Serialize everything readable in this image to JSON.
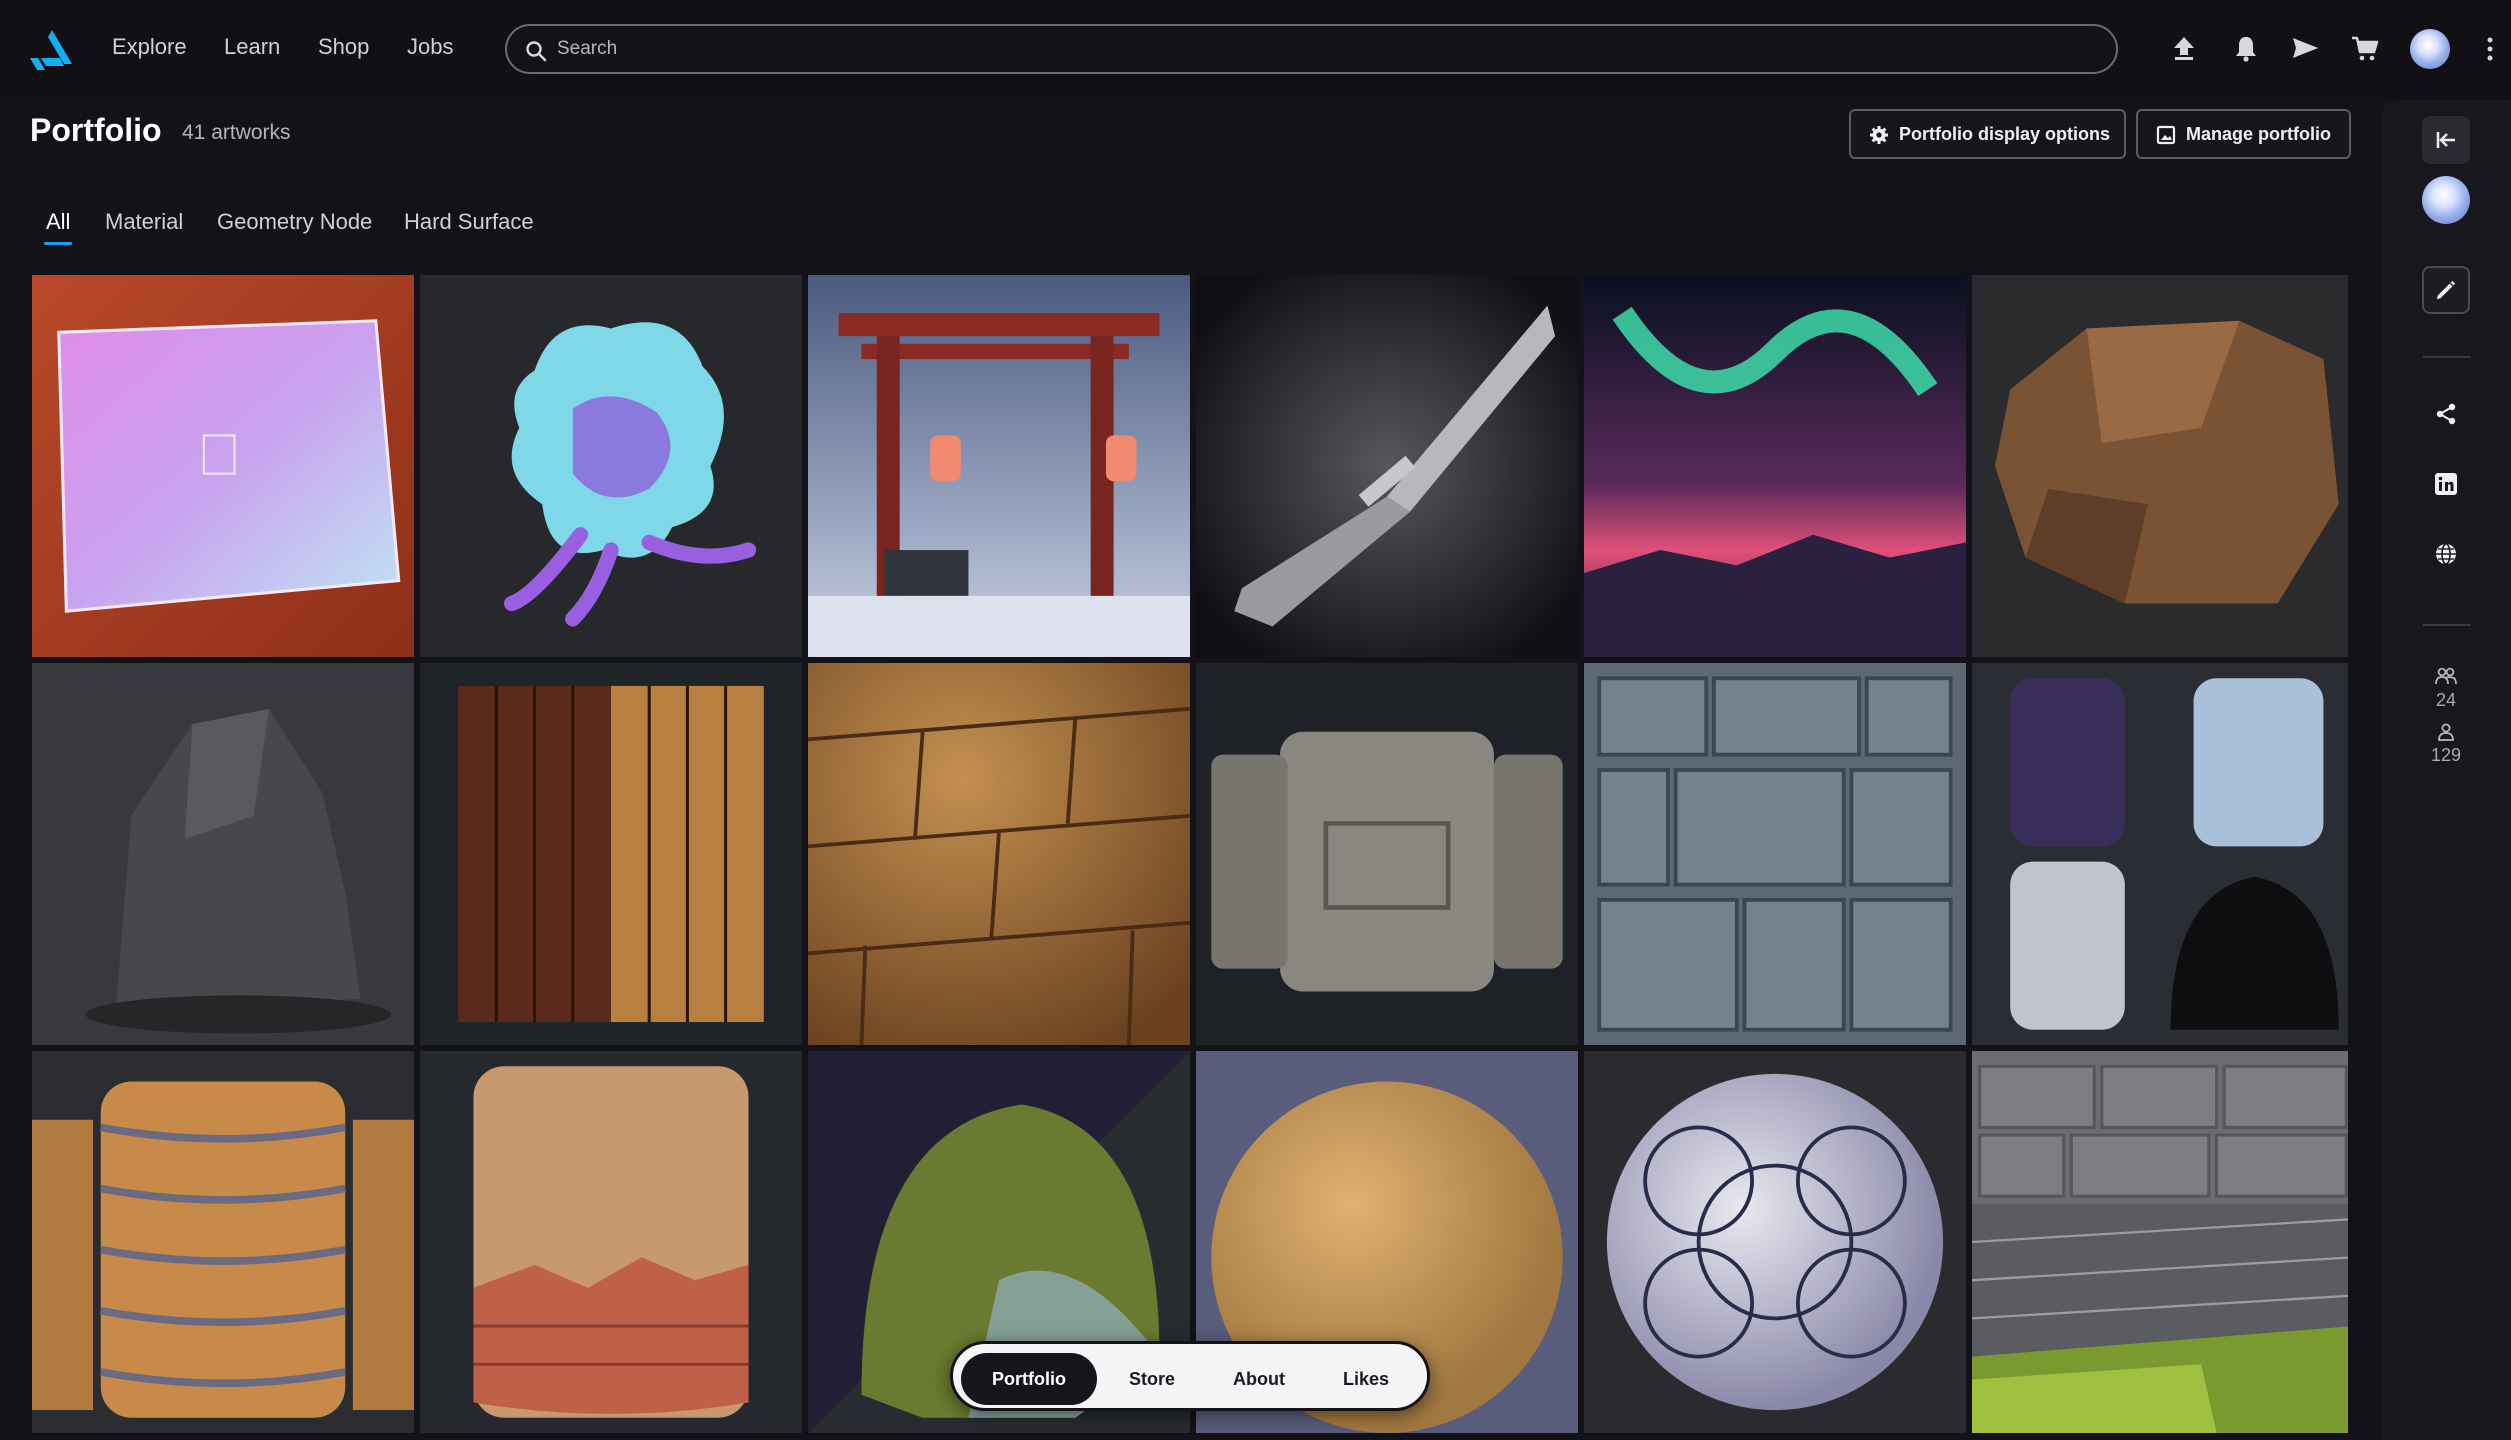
{
  "nav": {
    "links": [
      "Explore",
      "Learn",
      "Shop",
      "Jobs"
    ],
    "search_placeholder": "Search"
  },
  "header": {
    "title": "Portfolio",
    "count": "41 artworks",
    "display_options_label": "Portfolio display options",
    "manage_label": "Manage portfolio"
  },
  "tabs": [
    "All",
    "Material",
    "Geometry Node",
    "Hard Surface"
  ],
  "active_tab": "All",
  "bottom_nav": {
    "items": [
      "Portfolio",
      "Store",
      "About",
      "Likes"
    ],
    "active": "Portfolio"
  },
  "rail": {
    "following_count": "24",
    "followers_count": "129"
  },
  "colors": {
    "accent": "#1a9ff5",
    "background": "#121218",
    "panel": "#17171d"
  }
}
